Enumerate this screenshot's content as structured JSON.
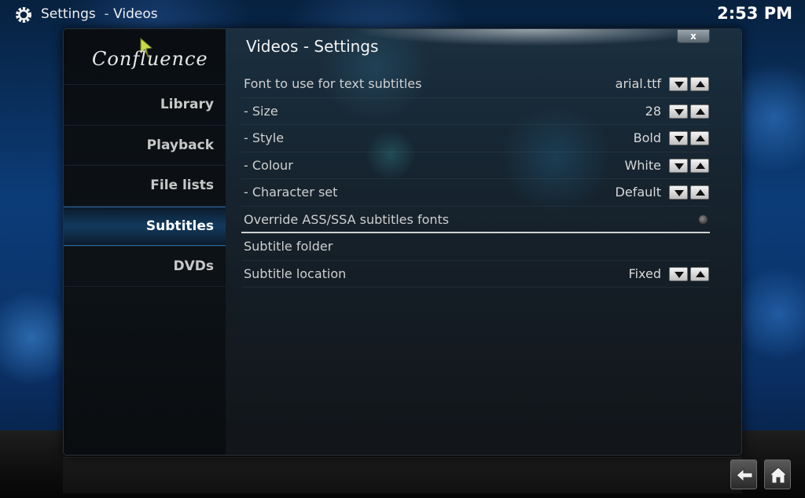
{
  "header": {
    "section": "Settings",
    "separator": "-",
    "subsection": "Videos",
    "clock": "2:53 PM"
  },
  "sidebar": {
    "logo_text": "Confluence",
    "items": [
      {
        "label": "Library",
        "active": false
      },
      {
        "label": "Playback",
        "active": false
      },
      {
        "label": "File lists",
        "active": false
      },
      {
        "label": "Subtitles",
        "active": true
      },
      {
        "label": "DVDs",
        "active": false
      }
    ]
  },
  "dialog": {
    "title": "Videos - Settings",
    "close_label": "x"
  },
  "settings": [
    {
      "label": "Font to use for text subtitles",
      "value": "arial.ttf",
      "control": "spin"
    },
    {
      "label": "- Size",
      "value": "28",
      "control": "spin"
    },
    {
      "label": "- Style",
      "value": "Bold",
      "control": "spin"
    },
    {
      "label": "- Colour",
      "value": "White",
      "control": "spin"
    },
    {
      "label": "- Character set",
      "value": "Default",
      "control": "spin"
    },
    {
      "label": "Override ASS/SSA subtitles fonts",
      "value": "",
      "control": "radio",
      "selected": true
    },
    {
      "label": "Subtitle folder",
      "value": "",
      "control": "none"
    },
    {
      "label": "Subtitle location",
      "value": "Fixed",
      "control": "spin"
    }
  ],
  "icons": {
    "gear": "gear-icon",
    "back": "back-arrow-icon",
    "home": "home-icon",
    "spin_down": "arrow-down-icon",
    "spin_up": "arrow-up-icon"
  }
}
